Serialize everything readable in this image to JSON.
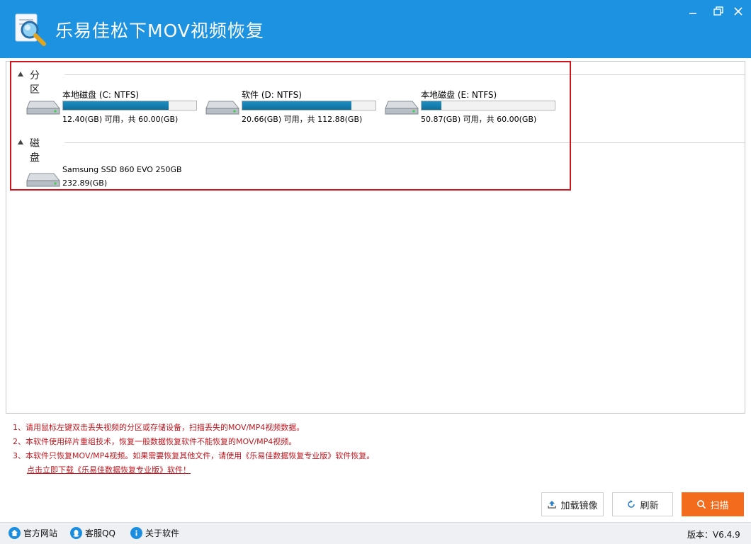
{
  "window": {
    "title": "乐易佳松下MOV视频恢复"
  },
  "sections": {
    "partitions_label": "分区",
    "disks_label": "磁盘"
  },
  "partitions": [
    {
      "name": "本地磁盘 (C: NTFS)",
      "capacity": "12.40(GB) 可用，共 60.00(GB)",
      "used_fraction": 0.79
    },
    {
      "name": "软件 (D: NTFS)",
      "capacity": "20.66(GB) 可用，共 112.88(GB)",
      "used_fraction": 0.82
    },
    {
      "name": "本地磁盘 (E: NTFS)",
      "capacity": "50.87(GB) 可用，共 60.00(GB)",
      "used_fraction": 0.15
    }
  ],
  "disks": [
    {
      "name": "Samsung SSD 860 EVO 250GB",
      "capacity": "232.89(GB)"
    }
  ],
  "notes": {
    "line1": "1、请用鼠标左键双击丢失视频的分区或存储设备，扫描丢失的MOV/MP4视频数据。",
    "line2": "2、本软件使用碎片重组技术，恢复一般数据恢复软件不能恢复的MOV/MP4视频。",
    "line3": "3、本软件只恢复MOV/MP4视频。如果需要恢复其他文件，请使用《乐易佳数据恢复专业版》软件恢复。",
    "download_link": "点击立即下载《乐易佳数据恢复专业版》软件！"
  },
  "buttons": {
    "load_image": "加载镜像",
    "refresh": "刷新",
    "scan": "扫描"
  },
  "footer": {
    "website": "官方网站",
    "qq": "客服QQ",
    "about": "关于软件",
    "version": "版本：V6.4.9"
  },
  "colors": {
    "titlebar": "#1c92e0",
    "progress": "#1e8fc4",
    "note_text": "#c0161e",
    "scan_button": "#f36b1c",
    "highlight_border": "#d0141c"
  }
}
